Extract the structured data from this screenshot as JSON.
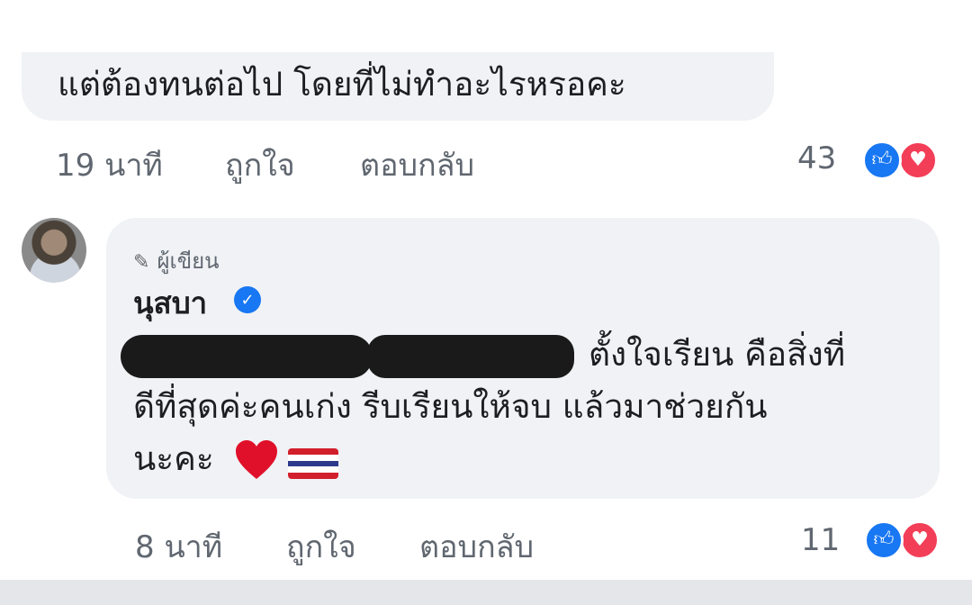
{
  "comment1": {
    "text": "แต่ต้องทนต่อไป โดยที่ไม่ทำอะไรหรอคะ",
    "time": "19 นาที",
    "like_label": "ถูกใจ",
    "reply_label": "ตอบกลับ",
    "reaction_count": "43"
  },
  "comment2": {
    "author_badge": "ผู้เขียน",
    "author_name": "นุสบา",
    "line1": "ตั้งใจเรียน คือสิ่งที่",
    "line2": "ดีที่สุดค่ะคนเก่ง รีบเรียนให้จบ แล้วมาช่วยกัน",
    "line3": "นะคะ",
    "emojis": [
      "heart",
      "thailand-flag"
    ],
    "time": "8 นาที",
    "like_label": "ถูกใจ",
    "reply_label": "ตอบกลับ",
    "reaction_count": "11"
  },
  "colors": {
    "bubble": "#f0f2f5",
    "like_blue": "#1877f2",
    "love_red": "#f33e58",
    "meta_gray": "#606770"
  }
}
